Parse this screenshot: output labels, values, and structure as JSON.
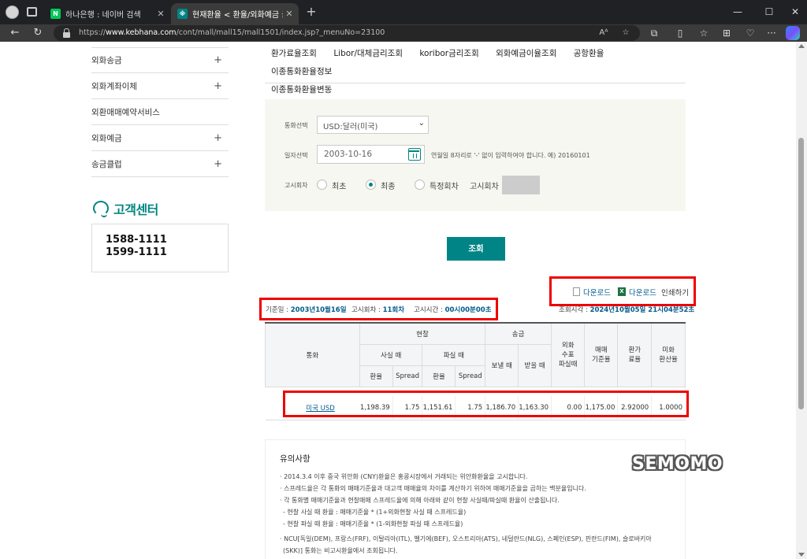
{
  "browser": {
    "tabs": [
      {
        "label": "하나은행 : 네이버 검색",
        "favicon": "N",
        "active": false
      },
      {
        "label": "현재환율 < 환율/외화예금 금리 <",
        "favicon": "hana",
        "active": true
      }
    ],
    "url_prefix": "https://",
    "url_host": "www.kebhana.com",
    "url_path": "/cont/mall/mall15/mall1501/index.jsp?_menuNo=23100",
    "reader_icon": "Aᴬ"
  },
  "sidebar": {
    "items": [
      {
        "label": "외화송금",
        "expandable": true
      },
      {
        "label": "외화계좌이체",
        "expandable": true
      },
      {
        "label": "외환매매예약서비스",
        "expandable": false
      },
      {
        "label": "외화예금",
        "expandable": true
      },
      {
        "label": "송금클럽",
        "expandable": true
      }
    ],
    "plus": "+",
    "customer_center": {
      "title": "고객센터",
      "phones": [
        "1588-1111",
        "1599-1111"
      ]
    }
  },
  "submenu": {
    "items": [
      "환가료율조회",
      "Libor/대체금리조회",
      "koribor금리조회",
      "외화예금이율조회",
      "공항환율",
      "이종통화환율정보",
      "이종통화환율변동"
    ]
  },
  "search": {
    "currency_label": "통화선택",
    "currency_value": "USD:달러(미국)",
    "date_label": "일자선택",
    "date_value": "2003-10-16",
    "date_hint": "연월일 8자리로 '-' 없이 입력하여야 합니다. 예) 20160101",
    "notice_label": "고시회차",
    "options": [
      "최초",
      "최종",
      "특정회차"
    ],
    "selected_option": "최종",
    "notice_round_label": "고시회차",
    "query_button": "조회"
  },
  "downloads": {
    "download1": "다운로드",
    "download2": "다운로드",
    "print": "인쇄하기"
  },
  "info": {
    "base_date_label": "기준일 : ",
    "base_date": "2003년10월16일",
    "round_label": "고시회차 : ",
    "round": "11회차",
    "time_label": "고시시간 : ",
    "time": "00시00분00초",
    "view_time_label": "조회시각 : ",
    "view_time": "2024년10월05일 21시04분52초"
  },
  "table": {
    "headers": {
      "currency": "통화",
      "cash": "현찰",
      "transfer": "송금",
      "check": "외화\n수표\n파실때",
      "base": "매매\n기준율",
      "conversion": "환가\n료율",
      "usd_rate": "미화\n환산율",
      "cash_buy": "사실 때",
      "cash_sell": "파실 때",
      "send": "보낼 때",
      "receive": "받을 때",
      "rate": "환율",
      "spread": "Spread"
    },
    "rows": [
      {
        "currency": "미국 USD",
        "cash_buy_rate": "1,198.39",
        "cash_buy_spread": "1.75",
        "cash_sell_rate": "1,151.61",
        "cash_sell_spread": "1.75",
        "send": "1,186.70",
        "receive": "1,163.30",
        "check": "0.00",
        "base": "1,175.00",
        "conversion": "2.92000",
        "usd_rate": "1.0000"
      }
    ]
  },
  "notes": {
    "title": "유의사항",
    "items": [
      "· 2014.3.4 이후 중국 위안화 (CNY)환율은 홍콩시장에서 거래되는 위안화환율을 고시합니다.",
      "· 스프레드율은 각 통화의 매매기준율과 대고객 매매율의 차이를 계산하기 위하여 매매기준율을 곱하는 백분율입니다.",
      "· 각 통화별 매매기준율과 현찰매매 스프레드율에 의해 아래와 같이 현찰 사실때/파실때 환율이 산출됩니다.",
      " - 현찰 사실 때 환율 : 매매기준율 * (1+외화현찰 사실 때 스프레드율)",
      " - 현찰 파실 때 환율 : 매매기준율 * (1-외화현찰 파실 때 스프레드율)",
      "· NCU[독일(DEM), 프랑스(FRF), 이탈리아(ITL), 벨기에(BEF), 오스트리아(ATS), 네덜란드(NLG), 스페인(ESP), 핀란드(FIM), 슬로바키아",
      "  (SKK)] 통화는 비고시환율에서 조회됩니다."
    ]
  },
  "watermark": "SEMOMO",
  "colors": {
    "accent": "#008485",
    "highlight": "#e00000",
    "link": "#005a8a"
  }
}
